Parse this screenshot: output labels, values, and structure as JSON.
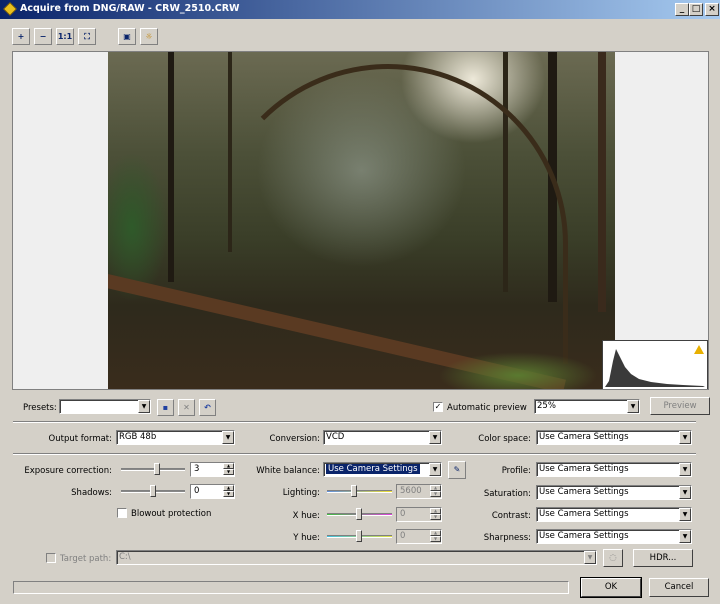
{
  "window": {
    "title": "Acquire from DNG/RAW - CRW_2510.CRW",
    "min": "_",
    "max": "□",
    "close": "×"
  },
  "toolbar": {
    "zoom_in": "+",
    "zoom_out": "−",
    "actual": "1:1",
    "fit": "⛶",
    "view_a": "▣",
    "view_b": "☼"
  },
  "presets": {
    "label": "Presets:",
    "value": ""
  },
  "automatic_preview": {
    "label": "Automatic preview",
    "checked": "✓"
  },
  "zoom": {
    "value": "25%"
  },
  "preview_button": "Preview",
  "output_format": {
    "label": "Output format:",
    "value": "RGB 48b"
  },
  "conversion": {
    "label": "Conversion:",
    "value": "VCD"
  },
  "color_space": {
    "label": "Color space:",
    "value": "Use Camera Settings"
  },
  "exposure": {
    "label": "Exposure correction:",
    "value": "3"
  },
  "shadows": {
    "label": "Shadows:",
    "value": "0"
  },
  "blowout": {
    "label": "Blowout protection"
  },
  "white_balance": {
    "label": "White balance:",
    "value": "Use Camera Settings"
  },
  "lighting": {
    "label": "Lighting:",
    "value": "5600"
  },
  "x_hue": {
    "label": "X hue:",
    "value": "0"
  },
  "y_hue": {
    "label": "Y hue:",
    "value": "0"
  },
  "profile": {
    "label": "Profile:",
    "value": "Use Camera Settings"
  },
  "saturation": {
    "label": "Saturation:",
    "value": "Use Camera Settings"
  },
  "contrast": {
    "label": "Contrast:",
    "value": "Use Camera Settings"
  },
  "sharpness": {
    "label": "Sharpness:",
    "value": "Use Camera Settings"
  },
  "target_path": {
    "label": "Target path:",
    "value": "C:\\"
  },
  "hdr_button": "HDR...",
  "ok_button": "OK",
  "cancel_button": "Cancel",
  "colors": {
    "accent": "#0a246a",
    "face": "#d4d0c8"
  }
}
